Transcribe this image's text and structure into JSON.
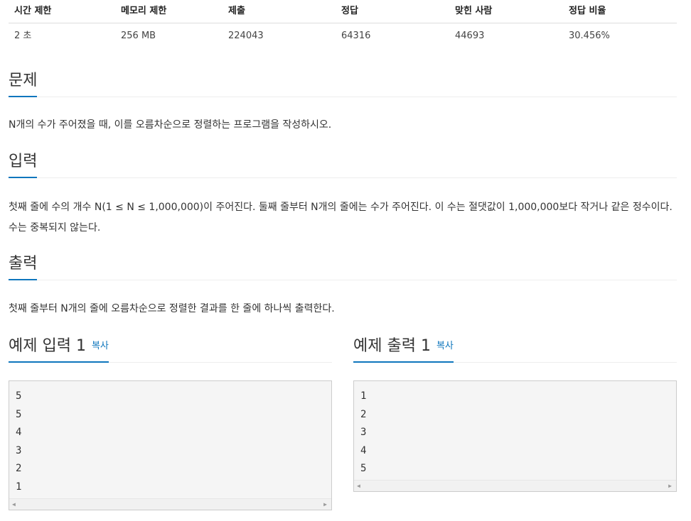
{
  "stats": {
    "headers": [
      "시간 제한",
      "메모리 제한",
      "제출",
      "정답",
      "맞힌 사람",
      "정답 비율"
    ],
    "values": [
      "2 초",
      "256 MB",
      "224043",
      "64316",
      "44693",
      "30.456%"
    ]
  },
  "problem": {
    "title": "문제",
    "text": "N개의 수가 주어졌을 때, 이를 오름차순으로 정렬하는 프로그램을 작성하시오."
  },
  "input": {
    "title": "입력",
    "text": "첫째 줄에 수의 개수 N(1 ≤ N ≤ 1,000,000)이 주어진다. 둘째 줄부터 N개의 줄에는 수가 주어진다. 이 수는 절댓값이 1,000,000보다 작거나 같은 정수이다. 수는 중복되지 않는다."
  },
  "output": {
    "title": "출력",
    "text": "첫째 줄부터 N개의 줄에 오름차순으로 정렬한 결과를 한 줄에 하나씩 출력한다."
  },
  "sample_input": {
    "title": "예제 입력 1",
    "copy_label": "복사",
    "lines": [
      "5",
      "5",
      "4",
      "3",
      "2",
      "1"
    ]
  },
  "sample_output": {
    "title": "예제 출력 1",
    "copy_label": "복사",
    "lines": [
      "1",
      "2",
      "3",
      "4",
      "5"
    ]
  },
  "colors": {
    "accent": "#0e76bd",
    "pre_bg": "#f5f5f5"
  }
}
